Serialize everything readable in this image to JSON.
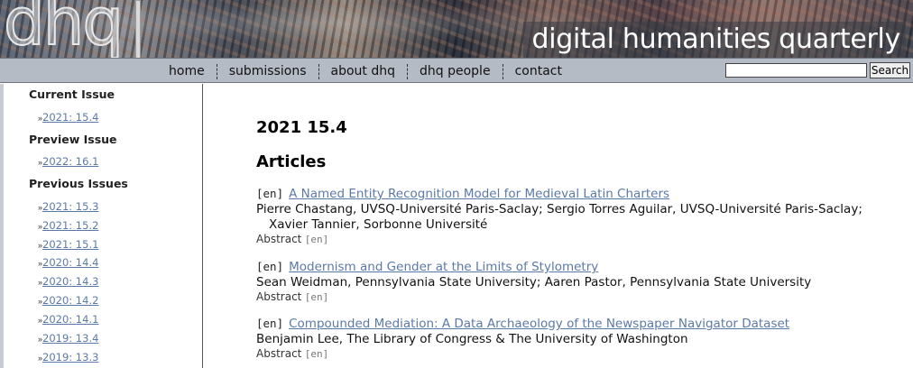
{
  "header": {
    "logo_text": "dhq",
    "site_title": "digital humanities quarterly"
  },
  "nav": {
    "items": [
      "home",
      "submissions",
      "about dhq",
      "dhq people",
      "contact"
    ],
    "search_button": "Search",
    "search_value": ""
  },
  "sidebar": {
    "current_heading": "Current Issue",
    "current_issue": "2021: 15.4",
    "preview_heading": "Preview Issue",
    "preview_issue": "2022: 16.1",
    "previous_heading": "Previous Issues",
    "previous_issues": [
      "2021: 15.3",
      "2021: 15.2",
      "2021: 15.1",
      "2020: 14.4",
      "2020: 14.3",
      "2020: 14.2",
      "2020: 14.1",
      "2019: 13.4",
      "2019: 13.3"
    ],
    "arrow": "»"
  },
  "main": {
    "issue_title": "2021 15.4",
    "section_heading": "Articles",
    "articles": [
      {
        "lang": "[en]",
        "title": "A Named Entity Recognition Model for Medieval Latin Charters",
        "authors": "Pierre Chastang, UVSQ-Université Paris-Saclay; Sergio Torres Aguilar, UVSQ-Université Paris-Saclay; Xavier Tannier, Sorbonne Université",
        "abstract_label": "Abstract",
        "abstract_lang": "[en]"
      },
      {
        "lang": "[en]",
        "title": "Modernism and Gender at the Limits of Stylometry",
        "authors": "Sean Weidman, Pennsylvania State University; Aaren Pastor, Pennsylvania State University",
        "abstract_label": "Abstract",
        "abstract_lang": "[en]"
      },
      {
        "lang": "[en]",
        "title": "Compounded Mediation: A Data Archaeology of the Newspaper Navigator Dataset",
        "authors": "Benjamin Lee, The Library of Congress & The University of Washington",
        "abstract_label": "Abstract",
        "abstract_lang": "[en]"
      }
    ]
  },
  "colors": {
    "link": "#5b79a8",
    "navbar": "#b4bbc4"
  }
}
